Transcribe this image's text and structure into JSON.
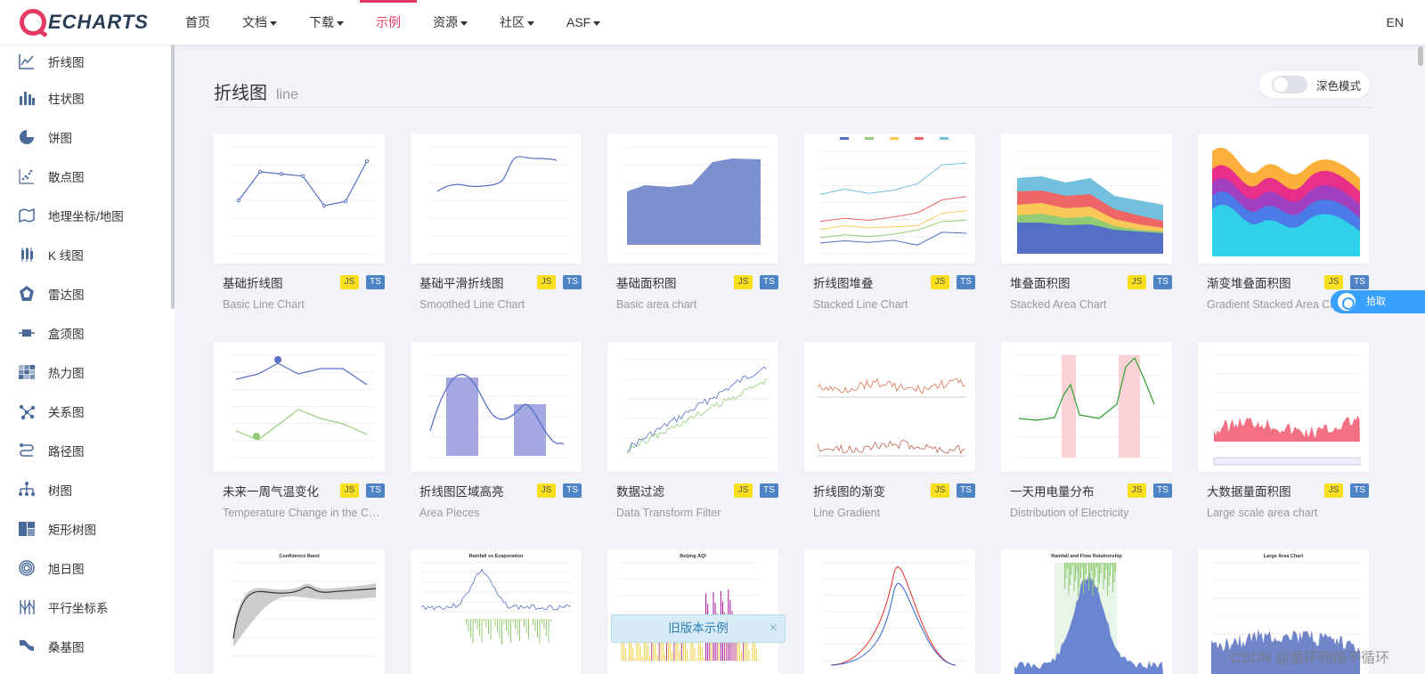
{
  "header": {
    "logo_text": "ECHARTS",
    "nav": [
      {
        "label": "首页",
        "dropdown": false
      },
      {
        "label": "文档",
        "dropdown": true
      },
      {
        "label": "下载",
        "dropdown": true
      },
      {
        "label": "示例",
        "dropdown": false,
        "active": true
      },
      {
        "label": "资源",
        "dropdown": true
      },
      {
        "label": "社区",
        "dropdown": true
      },
      {
        "label": "ASF",
        "dropdown": true
      }
    ],
    "lang": "EN"
  },
  "sidebar": {
    "items": [
      {
        "label": "折线图",
        "icon": "line-chart-icon"
      },
      {
        "label": "柱状图",
        "icon": "bar-chart-icon"
      },
      {
        "label": "饼图",
        "icon": "pie-chart-icon"
      },
      {
        "label": "散点图",
        "icon": "scatter-chart-icon"
      },
      {
        "label": "地理坐标/地图",
        "icon": "map-icon"
      },
      {
        "label": "K 线图",
        "icon": "candlestick-icon"
      },
      {
        "label": "雷达图",
        "icon": "radar-icon"
      },
      {
        "label": "盒须图",
        "icon": "boxplot-icon"
      },
      {
        "label": "热力图",
        "icon": "heatmap-icon"
      },
      {
        "label": "关系图",
        "icon": "graph-icon"
      },
      {
        "label": "路径图",
        "icon": "lines-icon"
      },
      {
        "label": "树图",
        "icon": "tree-icon"
      },
      {
        "label": "矩形树图",
        "icon": "treemap-icon"
      },
      {
        "label": "旭日图",
        "icon": "sunburst-icon"
      },
      {
        "label": "平行坐标系",
        "icon": "parallel-icon"
      },
      {
        "label": "桑基图",
        "icon": "sankey-icon"
      }
    ]
  },
  "main": {
    "heading_zh": "折线图",
    "heading_en": "line",
    "dark_mode_label": "深色模式",
    "badge_js": "JS",
    "badge_ts": "TS",
    "cards": [
      {
        "title": "基础折线图",
        "subtitle": "Basic Line Chart"
      },
      {
        "title": "基础平滑折线图",
        "subtitle": "Smoothed Line Chart"
      },
      {
        "title": "基础面积图",
        "subtitle": "Basic area chart"
      },
      {
        "title": "折线图堆叠",
        "subtitle": "Stacked Line Chart"
      },
      {
        "title": "堆叠面积图",
        "subtitle": "Stacked Area Chart"
      },
      {
        "title": "渐变堆叠面积图",
        "subtitle": "Gradient Stacked Area Chart"
      },
      {
        "title": "未来一周气温变化",
        "subtitle": "Temperature Change in the Coming Week"
      },
      {
        "title": "折线图区域高亮",
        "subtitle": "Area Pieces"
      },
      {
        "title": "数据过滤",
        "subtitle": "Data Transform Filter"
      },
      {
        "title": "折线图的渐变",
        "subtitle": "Line Gradient"
      },
      {
        "title": "一天用电量分布",
        "subtitle": "Distribution of Electricity"
      },
      {
        "title": "大数据量面积图",
        "subtitle": "Large scale area chart"
      }
    ],
    "third_row_titles": [
      "Confidence Band",
      "Rainfall vs Evaporation",
      "Beijing AQI",
      "",
      "Rainfall and Flow Relationship",
      "Large Area Chart"
    ],
    "old_version_label": "旧版本示例",
    "close_label": "×"
  },
  "float_button_label": "拾取",
  "watermark": "CSDN @循环网络不循环",
  "colors": {
    "accent": "#e43961",
    "brand_dark": "#293c55",
    "ts_badge": "#4e84c6",
    "js_badge": "#f7df1e"
  }
}
